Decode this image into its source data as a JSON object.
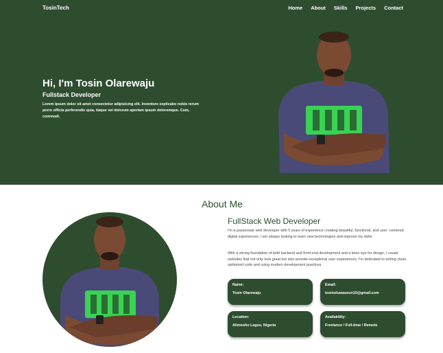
{
  "nav": {
    "brand": "TosinTech",
    "items": [
      {
        "label": "Home"
      },
      {
        "label": "About"
      },
      {
        "label": "Skills"
      },
      {
        "label": "Projects"
      },
      {
        "label": "Contact"
      }
    ]
  },
  "hero": {
    "title": "Hi, I'm Tosin Olarewaju",
    "subtitle": "Fullstack Developer",
    "description": "Lorem ipsum dolor sit amet consectetur adipisicing elit. Inventore explicabo nobis rerum porro officia perferendis quia, itaque vel dolorum aperiam ipsum doloremque. Cum, commodi."
  },
  "about": {
    "title": "About Me",
    "subtitle": "FullStack Web Developer",
    "paragraph1": "I'm a passionate web developer with 5 years of experience creating beautiful, functional, and user- centered digital experiences. I am always looking to learn new technologies and improve my skills.",
    "paragraph2": "With a strong foundation of both backend and front-end development and a keen eye for design, I create websites that not only look great but also provide exceptional user experiences. I'm dedicated to writing clean, optimized code and using modern development practices.",
    "cards": [
      {
        "label": "Name:",
        "value": "Tosin Olarewaju"
      },
      {
        "label": "Email:",
        "value": "tosinoluwaseun10@gmail.com"
      },
      {
        "label": "Location:",
        "value": "Alimosho Lagos, Nigeria"
      },
      {
        "label": "Availability:",
        "value": "Freelance / Full-time / Remote"
      }
    ]
  },
  "colors": {
    "primary": "#2e4d2f",
    "shirt": "#4a4a78",
    "shirt_print": "#39d353",
    "skin": "#7a4a32"
  },
  "icons": [
    "profile-photo",
    "profile-photo-circle"
  ]
}
